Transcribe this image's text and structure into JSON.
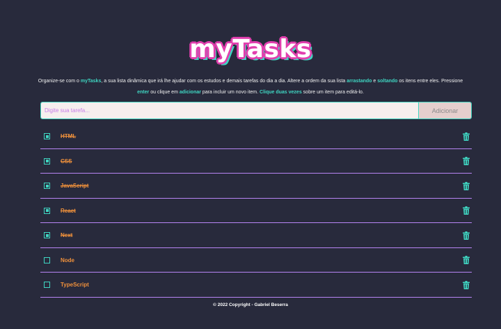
{
  "header": {
    "logo_text": "myTasks"
  },
  "intro": {
    "part1": "Organize-se com o ",
    "brand": "myTasks",
    "part2": ", a sua lista dinâmica que irá lhe ajudar com os estudos e demais tarefas do dia a dia. Altere a ordem da sua lista ",
    "drag": "arrastando",
    "part3": " e ",
    "drop": "soltando",
    "part4": " os itens entre eles. Pressione ",
    "enter": "enter",
    "part5": " ou clique em ",
    "add": "adicionar",
    "part6": " para incluir um novo item. ",
    "dblclick": "Clique duas vezes",
    "part7": " sobre um item para editá-lo."
  },
  "form": {
    "placeholder": "Digite sua tarefa...",
    "value": "",
    "add_label": "Adicionar"
  },
  "tasks": [
    {
      "label": "HTML",
      "checked": true
    },
    {
      "label": "CSS",
      "checked": true
    },
    {
      "label": "JavaScript",
      "checked": true
    },
    {
      "label": "React",
      "checked": true
    },
    {
      "label": "Next",
      "checked": true
    },
    {
      "label": "Node",
      "checked": false
    },
    {
      "label": "TypeScript",
      "checked": false
    }
  ],
  "icons": {
    "task_action": "trash-icon",
    "checkbox": "checkbox-icon"
  },
  "colors": {
    "background": "#282a3c",
    "accent": "#3fd6c2",
    "task_text": "#f0913b",
    "divider": "#b885f5",
    "logo_outline": "#e13fae"
  },
  "footer": {
    "text": "© 2022 Copyright - Gabriel Beserra"
  }
}
